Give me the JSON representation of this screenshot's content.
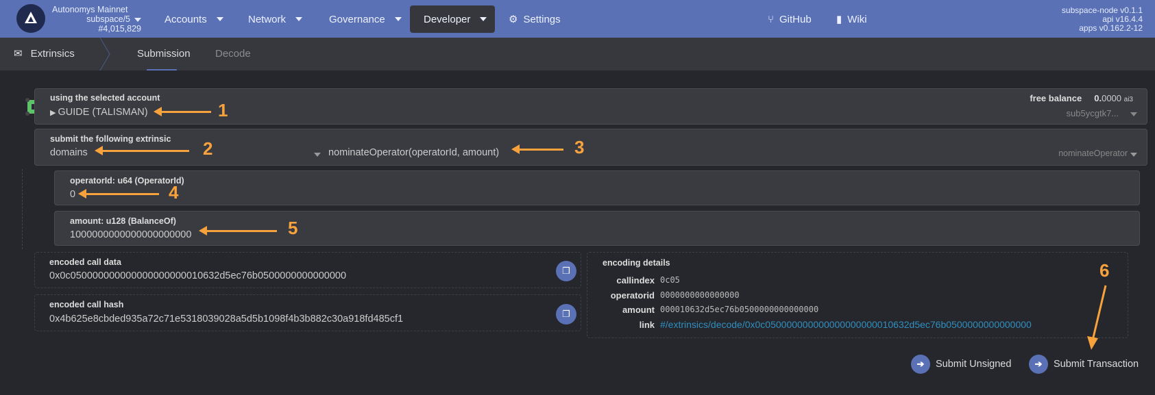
{
  "header": {
    "chain_name": "Autonomys Mainnet",
    "chain_spec": "subspace/5",
    "block": "#4,015,829",
    "nav": [
      "Accounts",
      "Network",
      "Governance",
      "Developer",
      "Settings"
    ],
    "links": [
      "GitHub",
      "Wiki"
    ],
    "versions": [
      "subspace-node v0.1.1",
      "api v16.4.4",
      "apps v0.162.2-12"
    ],
    "accent": "#5a71b5"
  },
  "subnav": {
    "section": "Extrinsics",
    "tabs": [
      "Submission",
      "Decode"
    ],
    "active": "Submission"
  },
  "account": {
    "label": "using the selected account",
    "name": "GUIDE (TALISMAN)",
    "balance_label": "free balance",
    "balance_int": "0.",
    "balance_dec": "0000",
    "balance_unit": "ai3",
    "address": "sub5ycgtk7..."
  },
  "extrinsic": {
    "label": "submit the following extrinsic",
    "section": "domains",
    "method": "nominateOperator(operatorId, amount)",
    "method_short": "nominateOperator"
  },
  "params": [
    {
      "label": "operatorId: u64 (OperatorId)",
      "value": "0"
    },
    {
      "label": "amount: u128 (BalanceOf)",
      "value": "1000000000000000000000"
    }
  ],
  "encoded": {
    "call_data_label": "encoded call data",
    "call_data": "0x0c050000000000000000000010632d5ec76b0500000000000000",
    "call_hash_label": "encoded call hash",
    "call_hash": "0x4b625e8cbded935a72c71e5318039028a5d5b1098f4b3b882c30a918fd485cf1"
  },
  "details": {
    "title": "encoding details",
    "rows": [
      {
        "k": "callindex",
        "v": "0c05"
      },
      {
        "k": "operatorid",
        "v": "0000000000000000"
      },
      {
        "k": "amount",
        "v": "000010632d5ec76b0500000000000000"
      },
      {
        "k": "link",
        "v": "#/extrinsics/decode/0x0c050000000000000000000010632d5ec76b0500000000000000"
      }
    ]
  },
  "actions": {
    "unsigned": "Submit Unsigned",
    "submit": "Submit Transaction"
  },
  "annotations": [
    "1",
    "2",
    "3",
    "4",
    "5",
    "6"
  ]
}
